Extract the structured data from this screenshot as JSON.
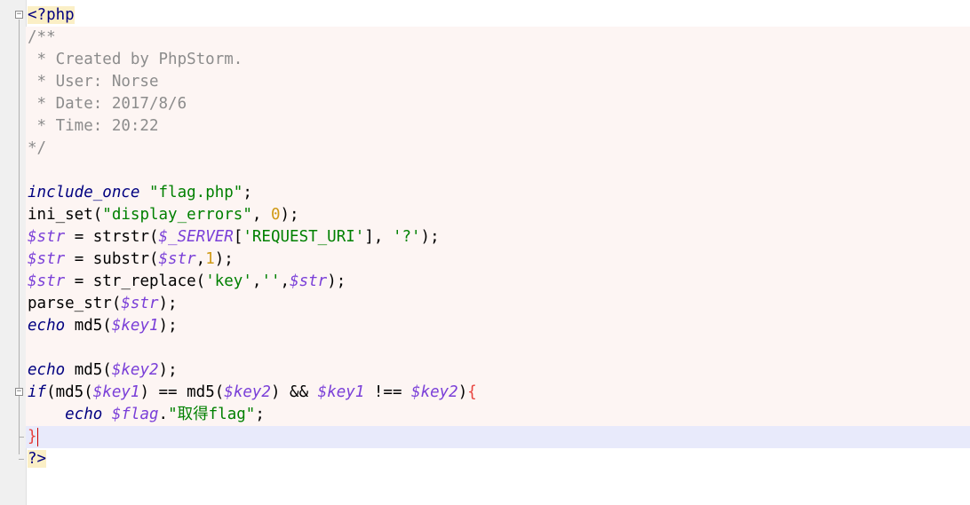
{
  "editor": {
    "language": "php",
    "colors": {
      "comment": "#8c8c8c",
      "keyword": "#000080",
      "string": "#008000",
      "variable": "#7a3fd8",
      "number": "#d09a16",
      "tag_background": "#fbefc6",
      "caret_line": "#e8eafb"
    },
    "lines": {
      "l1": {
        "open_tag": "<?php"
      },
      "l2": {
        "comment": "/**"
      },
      "l3": {
        "comment": " * Created by PhpStorm."
      },
      "l4": {
        "comment": " * User: Norse"
      },
      "l5": {
        "comment": " * Date: 2017/8/6"
      },
      "l6": {
        "comment": " * Time: 20:22"
      },
      "l7": {
        "comment": "*/"
      },
      "l9": {
        "kw": "include_once",
        "str": "\"flag.php\"",
        "end": ";"
      },
      "l10": {
        "fn": "ini_set(",
        "str": "\"display_errors\"",
        "sep": ", ",
        "num": "0",
        "end": ");"
      },
      "l11": {
        "var": "$str",
        "op": " = strstr(",
        "var2": "$_SERVER",
        "open": "[",
        "str": "'REQUEST_URI'",
        "mid": "], ",
        "str2": "'?'",
        "end": ");"
      },
      "l12": {
        "var": "$str",
        "op": " = substr(",
        "var2": "$str",
        "sep": ",",
        "num": "1",
        "end": ");"
      },
      "l13": {
        "var": "$str",
        "op": " = str_replace(",
        "str": "'key'",
        "sep": ",",
        "str2": "''",
        "sep2": ",",
        "var2": "$str",
        "end": ");"
      },
      "l14": {
        "fn": "parse_str(",
        "var": "$str",
        "end": ");"
      },
      "l15": {
        "kw": "echo",
        "fn": " md5(",
        "var": "$key1",
        "end": ");"
      },
      "l17": {
        "kw": "echo",
        "fn": " md5(",
        "var": "$key2",
        "end": ");"
      },
      "l18": {
        "kw": "if",
        "a": "(md5(",
        "var": "$key1",
        "b": ") == md5(",
        "var2": "$key2",
        "c": ") && ",
        "var3": "$key1",
        "d": " !== ",
        "var4": "$key2",
        "e": ")",
        "brace": "{"
      },
      "l19": {
        "indent": "    ",
        "kw": "echo",
        "sp": " ",
        "var": "$flag",
        "dot": ".",
        "str": "\"取得flag\"",
        "end": ";"
      },
      "l20": {
        "brace": "}"
      },
      "l21": {
        "close_tag": "?>"
      }
    }
  }
}
